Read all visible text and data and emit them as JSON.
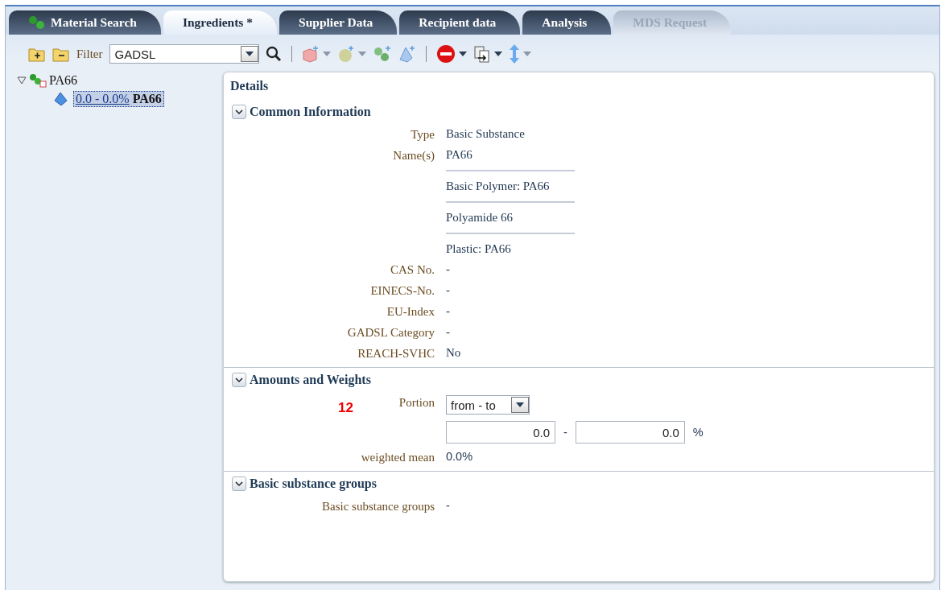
{
  "tabs": [
    {
      "label": "Material Search",
      "selected": false,
      "disabled": false
    },
    {
      "label": "Ingredients *",
      "selected": true,
      "disabled": false
    },
    {
      "label": "Supplier Data",
      "selected": false,
      "disabled": false
    },
    {
      "label": "Recipient data",
      "selected": false,
      "disabled": false
    },
    {
      "label": "Analysis",
      "selected": false,
      "disabled": false
    },
    {
      "label": "MDS Request",
      "selected": false,
      "disabled": true
    }
  ],
  "toolbar": {
    "filter_label": "Filter",
    "filter_value": "GADSL"
  },
  "tree": {
    "label": "PA66",
    "expanded": true,
    "children": [
      {
        "range": "0.0 - 0.0%",
        "name": "PA66",
        "selected": true
      }
    ]
  },
  "details": {
    "title": "Details",
    "sections": [
      {
        "title": "Common Information",
        "expanded": true,
        "rows": [
          {
            "kind": "text",
            "label": "Type",
            "values": [
              "Basic Substance"
            ]
          },
          {
            "kind": "list",
            "label": "Name(s)",
            "values": [
              "PA66",
              "Basic Polymer: PA66",
              "Polyamide 66",
              "Plastic: PA66"
            ]
          },
          {
            "kind": "text",
            "label": "CAS No.",
            "values": [
              "-"
            ]
          },
          {
            "kind": "text",
            "label": "EINECS-No.",
            "values": [
              "-"
            ]
          },
          {
            "kind": "text",
            "label": "EU-Index",
            "values": [
              "-"
            ]
          },
          {
            "kind": "text",
            "label": "GADSL Category",
            "values": [
              "-"
            ]
          },
          {
            "kind": "text",
            "label": "REACH-SVHC",
            "values": [
              "No"
            ]
          }
        ]
      },
      {
        "title": "Amounts and Weights",
        "expanded": true,
        "annotation": "12",
        "rows": [
          {
            "kind": "select",
            "label": "Portion",
            "values": [
              "from - to"
            ]
          },
          {
            "kind": "range",
            "values": [
              "0.0",
              "-",
              "0.0",
              "%"
            ]
          },
          {
            "kind": "sans-text",
            "label": "weighted mean",
            "values": [
              "0.0%"
            ]
          }
        ]
      },
      {
        "title": "Basic substance groups",
        "expanded": true,
        "rows": [
          {
            "kind": "sans-text",
            "label": "Basic substance groups",
            "values": [
              "-"
            ]
          }
        ]
      }
    ]
  }
}
